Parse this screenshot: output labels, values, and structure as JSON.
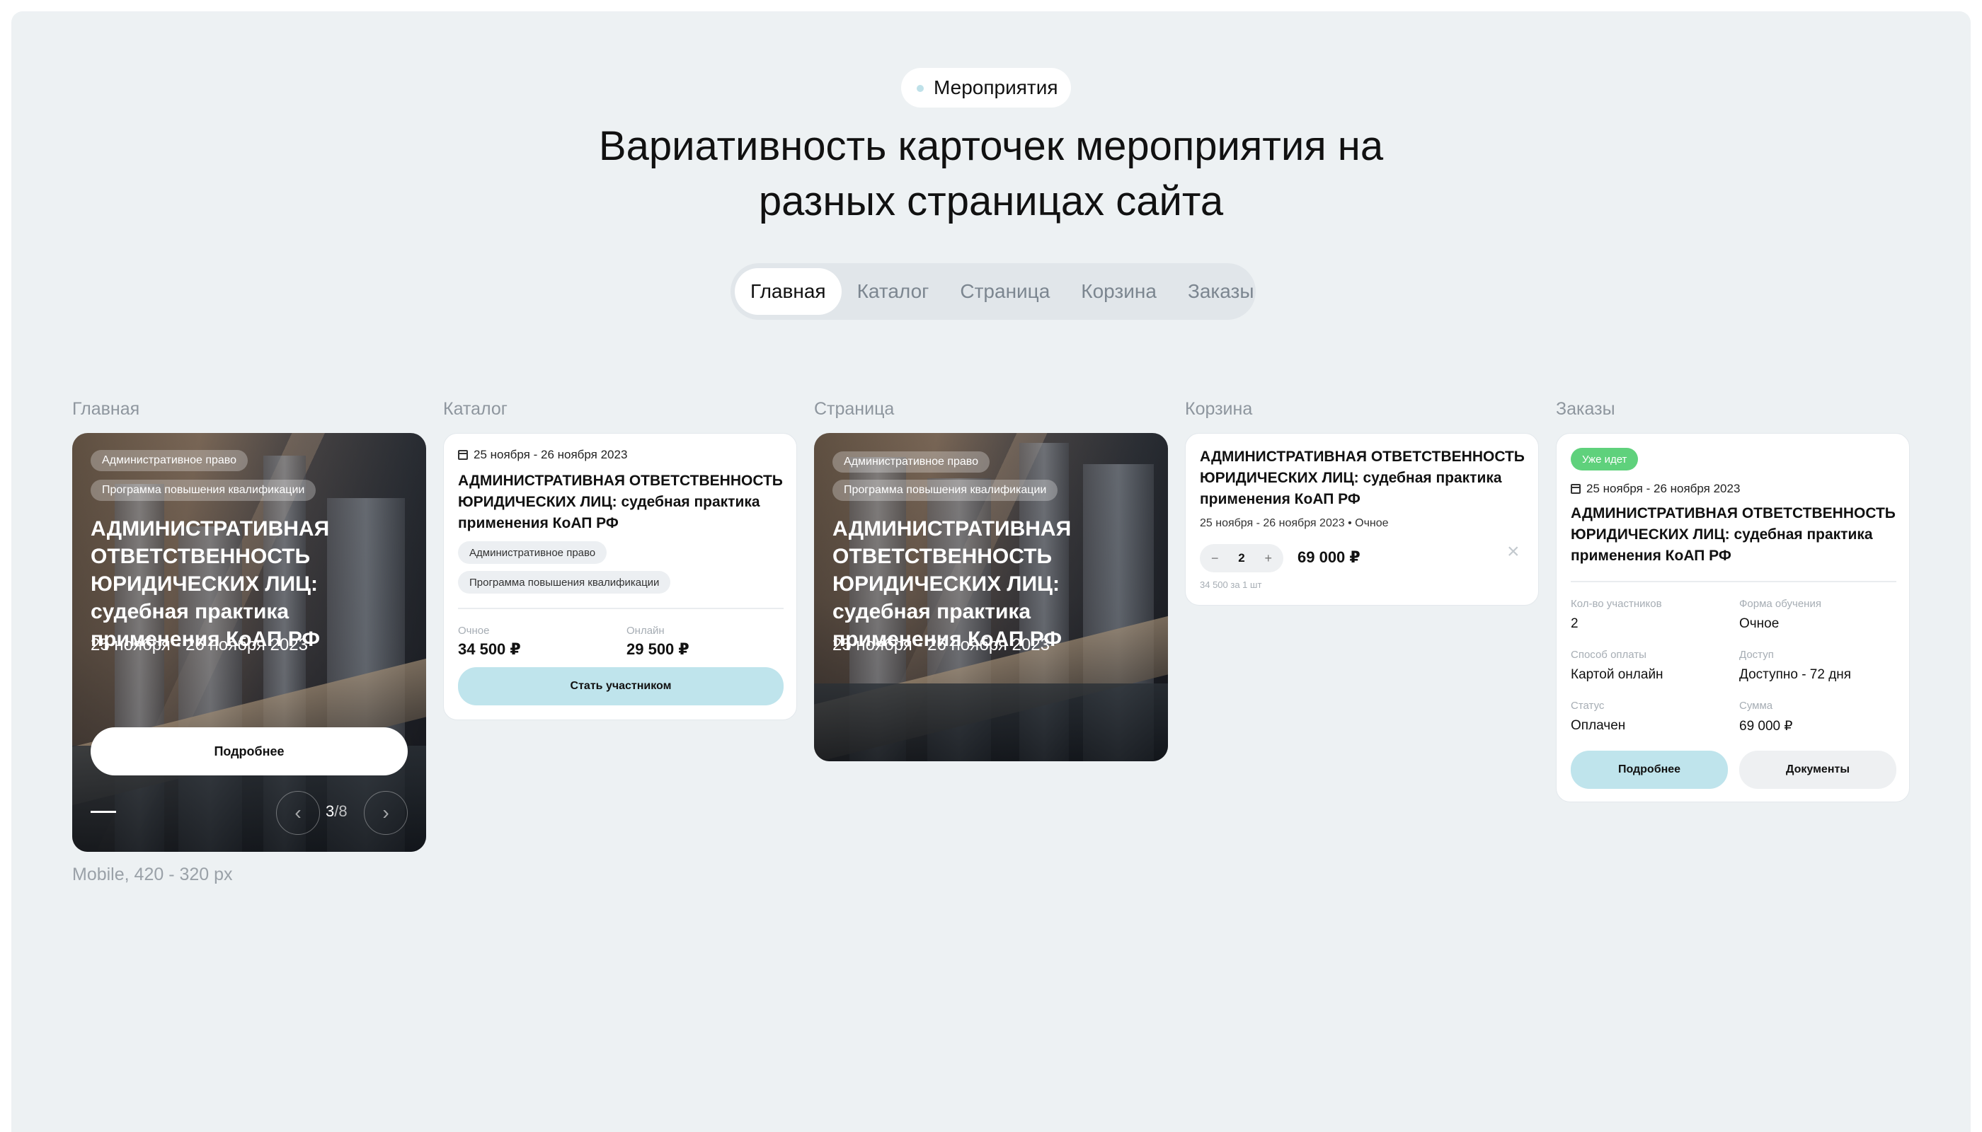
{
  "header": {
    "section": "Мероприятия",
    "title_line1": "Вариативность карточек мероприятия на",
    "title_line2": "разных страницах сайта"
  },
  "tabs": [
    "Главная",
    "Каталог",
    "Страница",
    "Корзина",
    "Заказы"
  ],
  "active_tab": "Главная",
  "columns": {
    "home": "Главная",
    "catalog": "Каталог",
    "page": "Страница",
    "cart": "Корзина",
    "orders": "Заказы"
  },
  "mobile_note": "Mobile, 420 - 320 px",
  "event": {
    "tag1": "Административное право",
    "tag2": "Программа повышения квалификации",
    "title_upper": "АДМИНИСТРАТИВНАЯ ОТВЕТСТВЕННОСТЬ ЮРИДИЧЕСКИХ ЛИЦ: судебная практика применения КоАП РФ",
    "date": "25 ноября - 26 ноября 2023"
  },
  "home_card": {
    "more_label": "Подробнее",
    "slide_current": "3",
    "slide_separator": "/",
    "slide_total": "8",
    "prev_icon": "chevron-left-icon",
    "next_icon": "chevron-right-icon"
  },
  "catalog_card": {
    "format1_label": "Очное",
    "format1_price": "34 500 ₽",
    "format2_label": "Онлайн",
    "format2_price": "29 500 ₽",
    "cta": "Стать участником"
  },
  "cart_card": {
    "meta": "25 ноября - 26 ноября 2023 • Очное",
    "minus": "−",
    "quantity": "2",
    "plus": "+",
    "price": "69 000 ₽",
    "unit_price": "34 500 за 1 шт",
    "remove_icon": "close-icon"
  },
  "orders_card": {
    "status_badge": "Уже идет",
    "fields": [
      {
        "label": "Кол-во участников",
        "value": "2"
      },
      {
        "label": "Форма обучения",
        "value": "Очное"
      },
      {
        "label": "Способ оплаты",
        "value": "Картой онлайн"
      },
      {
        "label": "Доступ",
        "value": "Доступно - 72 дня"
      },
      {
        "label": "Статус",
        "value": "Оплачен"
      },
      {
        "label": "Сумма",
        "value": "69 000 ₽"
      }
    ],
    "more_label": "Подробнее",
    "docs_label": "Документы"
  },
  "colors": {
    "background": "#edf1f3",
    "accent_cyan": "#bfe4ec",
    "badge_green": "#5fd17c"
  }
}
